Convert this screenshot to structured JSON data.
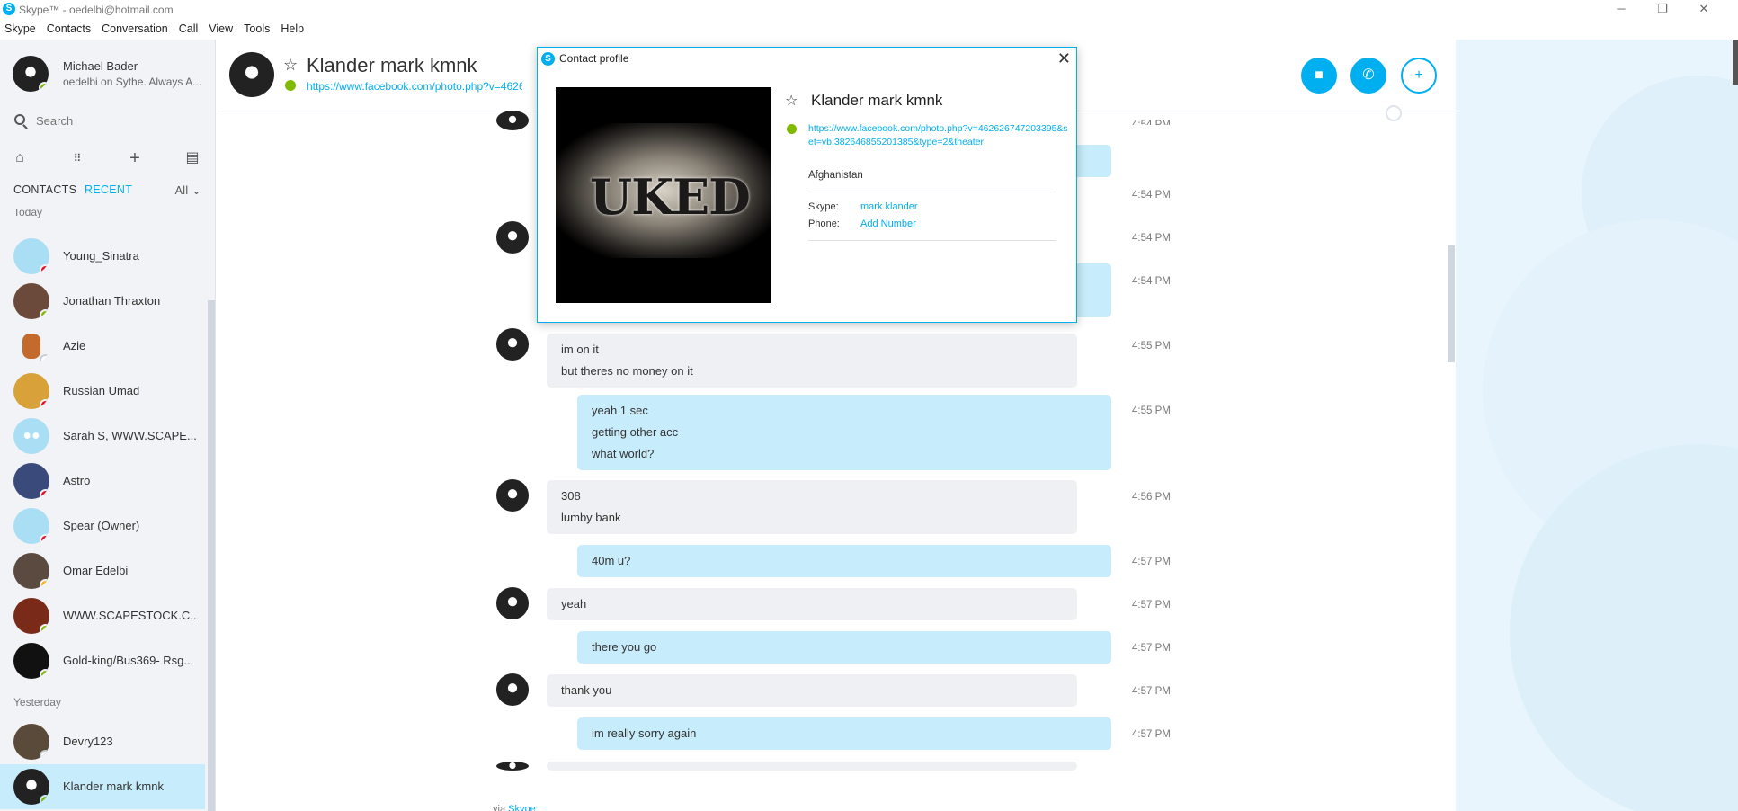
{
  "window": {
    "title": "Skype™ - oedelbi@hotmail.com",
    "logo": "S",
    "controls": [
      "minimize-icon",
      "restore-icon",
      "close-icon"
    ]
  },
  "menu": [
    "Skype",
    "Contacts",
    "Conversation",
    "Call",
    "View",
    "Tools",
    "Help"
  ],
  "me": {
    "name": "Michael Bader",
    "mood": "oedelbi on Sythe. Always A..."
  },
  "search": {
    "placeholder": "Search"
  },
  "tools": [
    "home-icon",
    "dialpad-icon",
    "add-icon",
    "contact-card-icon"
  ],
  "tabs": {
    "contacts": "CONTACTS",
    "recent": "RECENT",
    "filter": "All"
  },
  "sections": {
    "today": "Today",
    "yesterday": "Yesterday"
  },
  "contacts_today": [
    {
      "name": "Young_Sinatra",
      "status": "busy",
      "avatar": "default-avatar"
    },
    {
      "name": "Jonathan Thraxton",
      "status": "online",
      "avatar": "photo-avatar"
    },
    {
      "name": "Azie",
      "status": "unknown",
      "avatar": "gingerbread-avatar"
    },
    {
      "name": "Russian Umad",
      "status": "busy",
      "avatar": "photo-avatar"
    },
    {
      "name": "Sarah S, WWW.SCAPE...",
      "status": "none",
      "avatar": "group-avatar"
    },
    {
      "name": "Astro",
      "status": "busy",
      "avatar": "photo-avatar"
    },
    {
      "name": "Spear (Owner)",
      "status": "busy",
      "avatar": "default-avatar"
    },
    {
      "name": "Omar Edelbi",
      "status": "away",
      "avatar": "photo-avatar"
    },
    {
      "name": "WWW.SCAPESTOCK.C...",
      "status": "online",
      "avatar": "logo-avatar"
    },
    {
      "name": "Gold-king/Bus369- Rsg...",
      "status": "online",
      "avatar": "logo-avatar"
    }
  ],
  "contacts_yesterday": [
    {
      "name": "Devry123",
      "status": "offline",
      "avatar": "photo-avatar"
    },
    {
      "name": "Klander mark kmnk",
      "status": "online",
      "avatar": "logo-avatar",
      "active": true
    }
  ],
  "chat": {
    "contact_name": "Klander mark kmnk",
    "mood_link": "https://www.facebook.com/photo.php?v=46262",
    "buttons": [
      "video-call-icon",
      "call-icon",
      "add-contact-icon"
    ],
    "messages": [
      {
        "from": "them",
        "lines": [],
        "time": "4:54 PM"
      },
      {
        "from": "me",
        "lines": [],
        "time": "4:54 PM"
      },
      {
        "from": "them",
        "lines": [],
        "time": "4:54 PM"
      },
      {
        "from": "me",
        "lines": [],
        "time": "4:54 PM"
      },
      {
        "from": "them",
        "lines": [
          "im on it",
          "but theres no money on it"
        ],
        "time": "4:55 PM"
      },
      {
        "from": "me",
        "lines": [
          "yeah 1 sec",
          "getting other acc",
          "what world?"
        ],
        "time": "4:55 PM"
      },
      {
        "from": "them",
        "lines": [
          "308",
          "lumby bank"
        ],
        "time": "4:56 PM"
      },
      {
        "from": "me",
        "lines": [
          "40m u?"
        ],
        "time": "4:57 PM"
      },
      {
        "from": "them",
        "lines": [
          "yeah"
        ],
        "time": "4:57 PM"
      },
      {
        "from": "me",
        "lines": [
          "there you go"
        ],
        "time": "4:57 PM"
      },
      {
        "from": "them",
        "lines": [
          "thank you"
        ],
        "time": "4:57 PM"
      },
      {
        "from": "me",
        "lines": [
          "im really sorry again"
        ],
        "time": "4:57 PM"
      }
    ],
    "via": {
      "prefix": "via",
      "service": "Skype"
    }
  },
  "profile_dialog": {
    "title": "Contact profile",
    "logo": "S",
    "photo_text": "UKED",
    "name": "Klander mark kmnk",
    "link": "https://www.facebook.com/photo.php?v=462626747203395&set=vb.382646855201385&type=2&theater",
    "country": "Afghanistan",
    "skype_label": "Skype:",
    "skype_value": "mark.klander",
    "phone_label": "Phone:",
    "phone_value": "Add Number"
  },
  "colors": {
    "accent": "#00aff0",
    "online": "#7fba00",
    "busy": "#e81123",
    "away": "#fdb813",
    "bubble_in": "#eef0f3",
    "bubble_out": "#c7ecfb",
    "sidebar_bg": "#f1f3f6"
  }
}
